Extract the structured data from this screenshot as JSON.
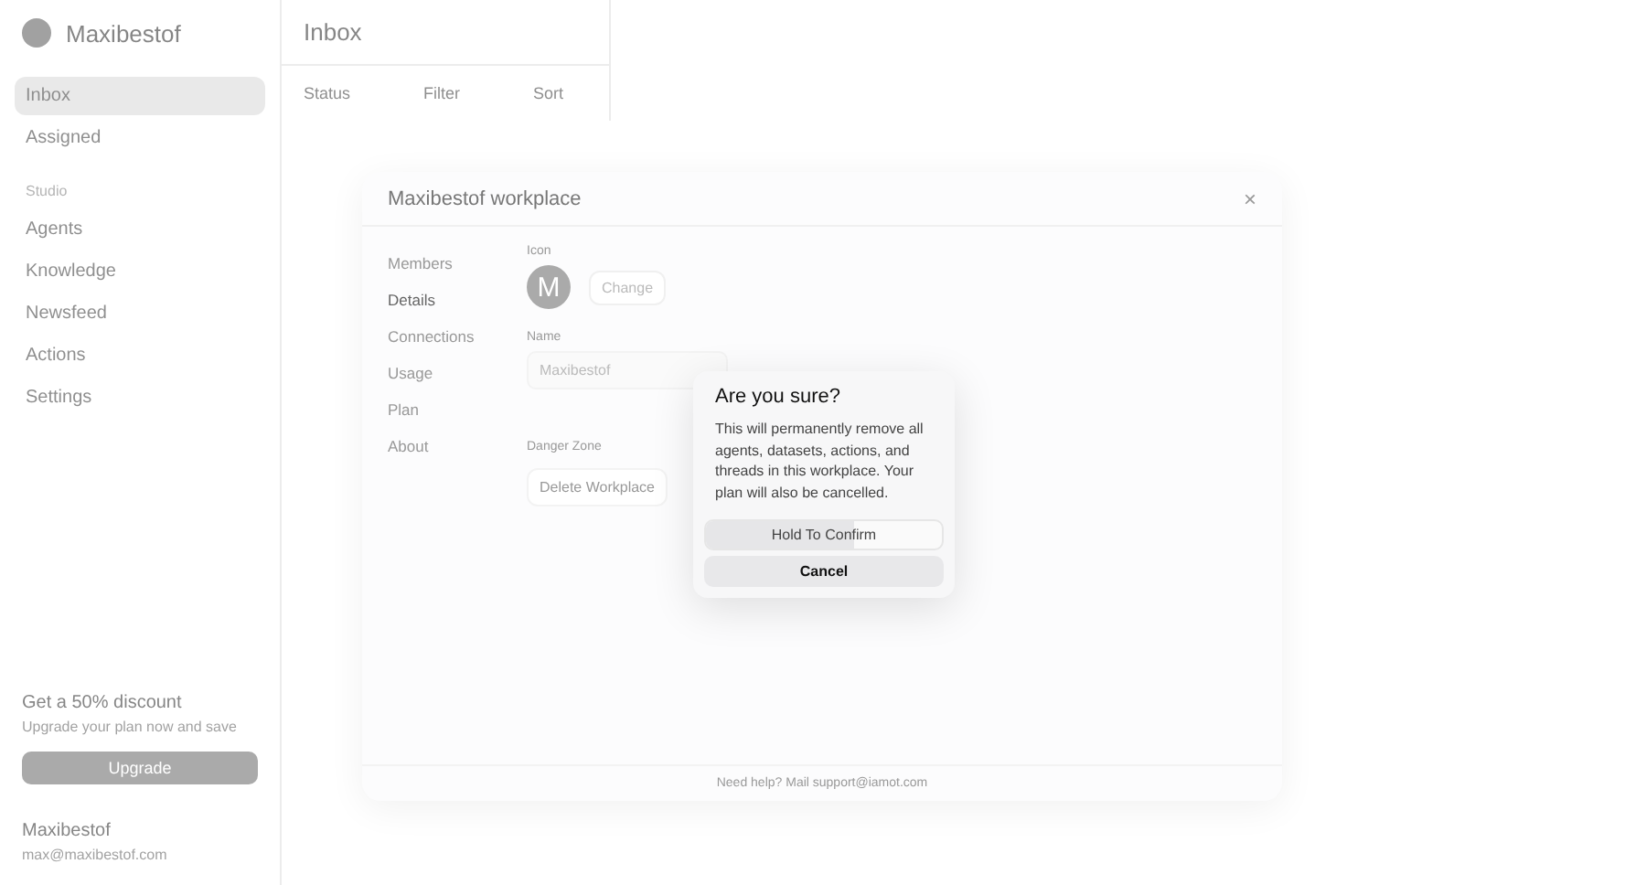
{
  "sidebar": {
    "workspace": "Maxibestof",
    "items": [
      {
        "label": "Inbox",
        "selected": true
      },
      {
        "label": "Assigned",
        "selected": false
      }
    ],
    "section": "Studio",
    "studio_items": [
      {
        "label": "Agents"
      },
      {
        "label": "Knowledge"
      },
      {
        "label": "Newsfeed"
      },
      {
        "label": "Actions"
      },
      {
        "label": "Settings"
      }
    ],
    "promo": {
      "title": "Get a 50% discount",
      "text": "Upgrade your plan now and save",
      "button": "Upgrade"
    },
    "user": {
      "name": "Maxibestof",
      "email": "max@maxibestof.com"
    }
  },
  "main": {
    "title": "Inbox",
    "toolbar": {
      "status": "Status",
      "filter": "Filter",
      "sort": "Sort"
    }
  },
  "settings_dialog": {
    "title": "Maxibestof workplace",
    "close": "×",
    "nav": [
      {
        "label": "Members",
        "selected": false
      },
      {
        "label": "Details",
        "selected": true
      },
      {
        "label": "Connections",
        "selected": false
      },
      {
        "label": "Usage",
        "selected": false
      },
      {
        "label": "Plan",
        "selected": false
      },
      {
        "label": "About",
        "selected": false
      }
    ],
    "icon_label": "Icon",
    "avatar_letter": "M",
    "change_button": "Change",
    "name_label": "Name",
    "name_value": "Maxibestof",
    "danger_label": "Danger Zone",
    "delete_button": "Delete Workplace",
    "footer": "Need help? Mail support@iamot.com"
  },
  "confirm": {
    "title": "Are you sure?",
    "text": "This will permanently remove all agents, datasets, actions, and threads in this workplace. Your plan will also be cancelled.",
    "confirm_button": "Hold To Confirm",
    "level": 0.63,
    "cancel_button": "Cancel"
  }
}
